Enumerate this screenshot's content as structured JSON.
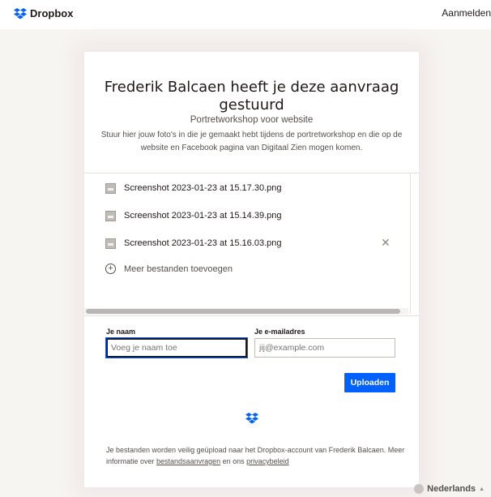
{
  "header": {
    "brand": "Dropbox",
    "signin": "Aanmelden"
  },
  "request": {
    "title": "Frederik Balcaen heeft je deze aanvraag gestuurd",
    "subtitle": "Portretworkshop voor website",
    "description": "Stuur hier jouw foto's in die je gemaakt hebt tijdens de portretworkshop en die op de website en Facebook pagina van Digitaal Zien mogen komen."
  },
  "files": [
    {
      "name": "Screenshot 2023-01-23 at 15.17.30.png"
    },
    {
      "name": "Screenshot 2023-01-23 at 15.14.39.png"
    },
    {
      "name": "Screenshot 2023-01-23 at 15.16.03.png"
    }
  ],
  "add_more": "Meer bestanden toevoegen",
  "form": {
    "name_label": "Je naam",
    "name_placeholder": "Voeg je naam toe",
    "email_label": "Je e-mailadres",
    "email_placeholder": "jij@example.com",
    "upload_label": "Uploaden"
  },
  "footer": {
    "text_before": "Je bestanden worden veilig geüpload naar het Dropbox-account van Frederik Balcaen. Meer informatie over ",
    "link1": "bestandsaanvragen",
    "text_mid": " en ons ",
    "link2": "privacybeleid"
  },
  "language": "Nederlands",
  "colors": {
    "accent": "#0061fe",
    "background": "#f7f5f2"
  }
}
